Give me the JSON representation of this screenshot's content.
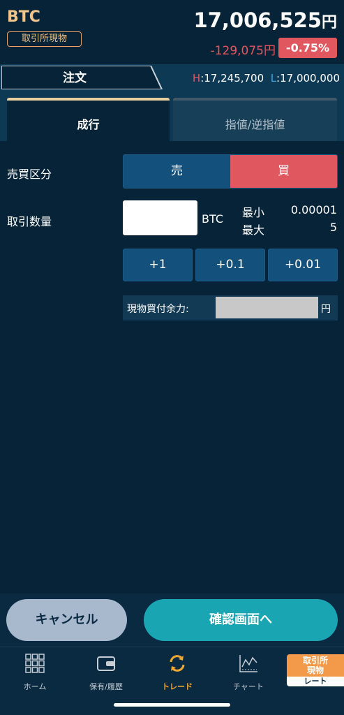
{
  "header": {
    "symbol": "BTC",
    "market_badge": "取引所現物",
    "price": "17,006,525",
    "price_unit": "円",
    "change": "-129,075円",
    "change_pct": "-0.75%"
  },
  "order_bar": {
    "tab": "注文",
    "high_label": "H",
    "high": "17,245,700",
    "low_label": "L",
    "low": "17,000,000"
  },
  "mode_tabs": {
    "active": "成行",
    "inactive": "指値/逆指値"
  },
  "form": {
    "side_label": "売買区分",
    "sell": "売",
    "buy": "買",
    "qty_label": "取引数量",
    "qty_value": "",
    "qty_unit": "BTC",
    "min_label": "最小",
    "min_value": "0.00001",
    "max_label": "最大",
    "max_value": "5",
    "steps": [
      "+1",
      "+0.1",
      "+0.01"
    ],
    "available_label": "現物買付余力:",
    "available_unit": "円"
  },
  "actions": {
    "cancel": "キャンセル",
    "confirm": "確認画面へ"
  },
  "nav": {
    "items": [
      {
        "label": "ホーム",
        "icon": "grid-icon"
      },
      {
        "label": "保有/履歴",
        "icon": "wallet-icon"
      },
      {
        "label": "トレード",
        "icon": "refresh-icon"
      },
      {
        "label": "チャート",
        "icon": "chart-icon"
      }
    ],
    "rate_top": "取引所\n現物",
    "rate_bottom": "レート"
  },
  "colors": {
    "background": "#072337",
    "accent_gold": "#f0c48a",
    "down_red": "#e0575f",
    "low_blue": "#3ea6e0",
    "confirm_teal": "#1aa5b3",
    "trade_orange": "#f0a832"
  }
}
